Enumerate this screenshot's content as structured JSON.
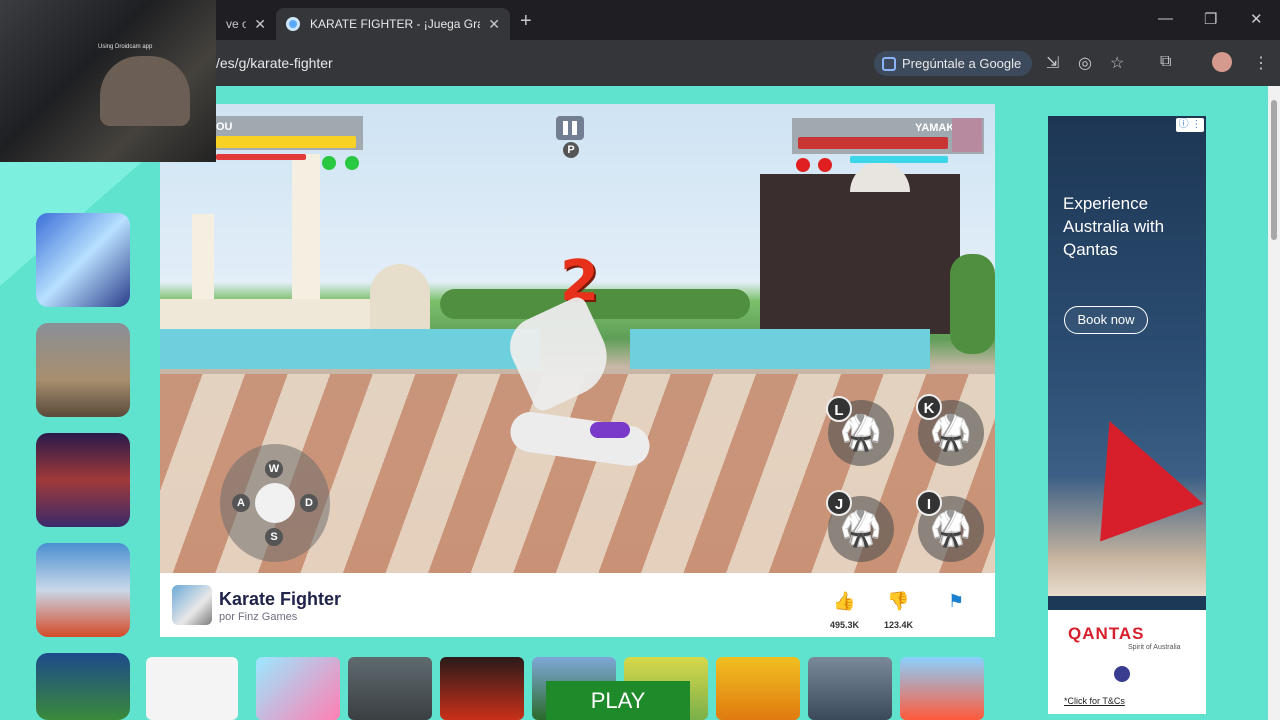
{
  "browser": {
    "tabs": [
      {
        "title": "ve o",
        "active": false
      },
      {
        "title": "KARATE FIGHTER - ¡Juega Grati",
        "active": true
      }
    ],
    "url": "/es/g/karate-fighter",
    "ask_google_label": "Pregúntale a Google",
    "new_tab": "+",
    "close": "✕",
    "minimize": "—",
    "restore": "❐"
  },
  "webcam": {
    "watermark": "Using Droidcam app"
  },
  "sidebar": {
    "icons": [
      "smile-icon",
      "search-icon"
    ],
    "thumbs": [
      "dragon-fighter-3v3",
      "street-shooter",
      "boxing-match",
      "jail-boxer",
      "soccer-players"
    ]
  },
  "game": {
    "left_player": "OU",
    "right_player": "YAMAKI",
    "countdown": "2",
    "pause_key": "P",
    "move_keys": {
      "up": "W",
      "left": "A",
      "right": "D",
      "down": "S"
    },
    "attack_keys": [
      "L",
      "K",
      "J",
      "I"
    ],
    "left_rounds_color": "#28c840",
    "right_rounds_color": "#e02020"
  },
  "info": {
    "title": "Karate Fighter",
    "author": "por Finz Games",
    "likes": "495.3K",
    "dislikes": "123.4K"
  },
  "bottom_row": {
    "play_label": "PLAY"
  },
  "ad": {
    "headline": "Experience Australia with Qantas",
    "button": "Book now",
    "brand": "QANTAS",
    "tagline": "Spirit of Australia",
    "terms": "*Click for T&Cs"
  },
  "colors": {
    "page_bg": "#5fe3cf",
    "accent": "#1a7fd0"
  }
}
